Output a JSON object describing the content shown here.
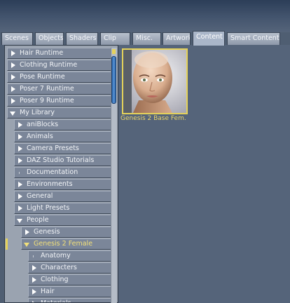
{
  "tabs": [
    {
      "label": "Scenes",
      "active": false
    },
    {
      "label": "Objects",
      "active": false
    },
    {
      "label": "Shaders",
      "active": false
    },
    {
      "label": "Clip",
      "active": false
    },
    {
      "label": "Misc.",
      "active": false
    },
    {
      "label": "Artwork",
      "active": false
    },
    {
      "label": "Content",
      "active": true
    },
    {
      "label": "Smart Content",
      "active": false
    }
  ],
  "tree": [
    {
      "label": "Hair Runtime",
      "level": 0,
      "toggle": "collapsed"
    },
    {
      "label": "Clothing Runtime",
      "level": 0,
      "toggle": "collapsed"
    },
    {
      "label": "Pose Runtime",
      "level": 0,
      "toggle": "collapsed"
    },
    {
      "label": "Poser 7 Runtime",
      "level": 0,
      "toggle": "collapsed"
    },
    {
      "label": "Poser 9 Runtime",
      "level": 0,
      "toggle": "collapsed"
    },
    {
      "label": "My Library",
      "level": 0,
      "toggle": "expanded"
    },
    {
      "label": "aniBlocks",
      "level": 1,
      "toggle": "collapsed"
    },
    {
      "label": "Animals",
      "level": 1,
      "toggle": "collapsed"
    },
    {
      "label": "Camera Presets",
      "level": 1,
      "toggle": "collapsed"
    },
    {
      "label": "DAZ Studio Tutorials",
      "level": 1,
      "toggle": "collapsed"
    },
    {
      "label": "Documentation",
      "level": 1,
      "toggle": "none"
    },
    {
      "label": "Environments",
      "level": 1,
      "toggle": "collapsed"
    },
    {
      "label": "General",
      "level": 1,
      "toggle": "collapsed"
    },
    {
      "label": "Light Presets",
      "level": 1,
      "toggle": "collapsed"
    },
    {
      "label": "People",
      "level": 1,
      "toggle": "expanded"
    },
    {
      "label": "Genesis",
      "level": 2,
      "toggle": "collapsed"
    },
    {
      "label": "Genesis 2 Female",
      "level": 2,
      "toggle": "expanded",
      "selected": true
    },
    {
      "label": "Anatomy",
      "level": 3,
      "toggle": "none"
    },
    {
      "label": "Characters",
      "level": 3,
      "toggle": "collapsed"
    },
    {
      "label": "Clothing",
      "level": 3,
      "toggle": "collapsed"
    },
    {
      "label": "Hair",
      "level": 3,
      "toggle": "collapsed"
    },
    {
      "label": "Materials",
      "level": 3,
      "toggle": "collapsed"
    }
  ],
  "content": {
    "items": [
      {
        "caption": "Genesis 2 Base Fem.",
        "icon": "genesis-2-female-portrait-icon"
      }
    ]
  },
  "colors": {
    "accent_yellow": "#e5d25a",
    "selected_text": "#f2e07a",
    "scrollbar_blue": "#3f7fc4"
  }
}
